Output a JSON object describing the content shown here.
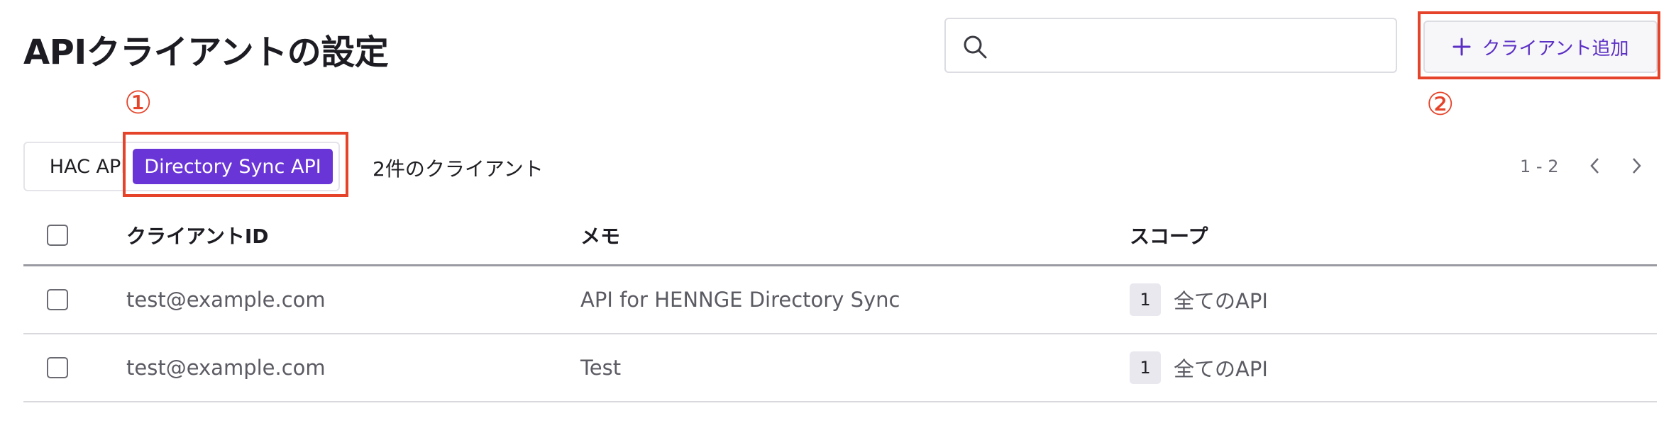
{
  "page": {
    "title": "APIクライアントの設定"
  },
  "search": {
    "placeholder": "",
    "value": ""
  },
  "toolbar": {
    "add_client_label": "クライアント追加"
  },
  "annotations": {
    "marker_1": "①",
    "marker_2": "②",
    "color": "#e5432a"
  },
  "api_tabs": [
    {
      "label": "HAC API",
      "selected": false
    },
    {
      "label": "Directory Sync API",
      "selected": true
    }
  ],
  "client_count_text": "2件のクライアント",
  "pagination": {
    "range": "1 - 2"
  },
  "table": {
    "columns": [
      "クライアントID",
      "メモ",
      "スコープ"
    ],
    "rows": [
      {
        "client_id": "test@example.com",
        "memo": "API for HENNGE Directory Sync",
        "scope_count": "1",
        "scope_label": "全てのAPI",
        "checked": false
      },
      {
        "client_id": "test@example.com",
        "memo": "Test",
        "scope_count": "1",
        "scope_label": "全てのAPI",
        "checked": false
      }
    ]
  },
  "colors": {
    "accent": "#6a35d6",
    "accent_text": "#5b2fc4",
    "annotation": "#e5432a"
  },
  "icons": {
    "search": "search-icon",
    "add": "plus-icon",
    "prev": "chevron-left-icon",
    "next": "chevron-right-icon"
  }
}
